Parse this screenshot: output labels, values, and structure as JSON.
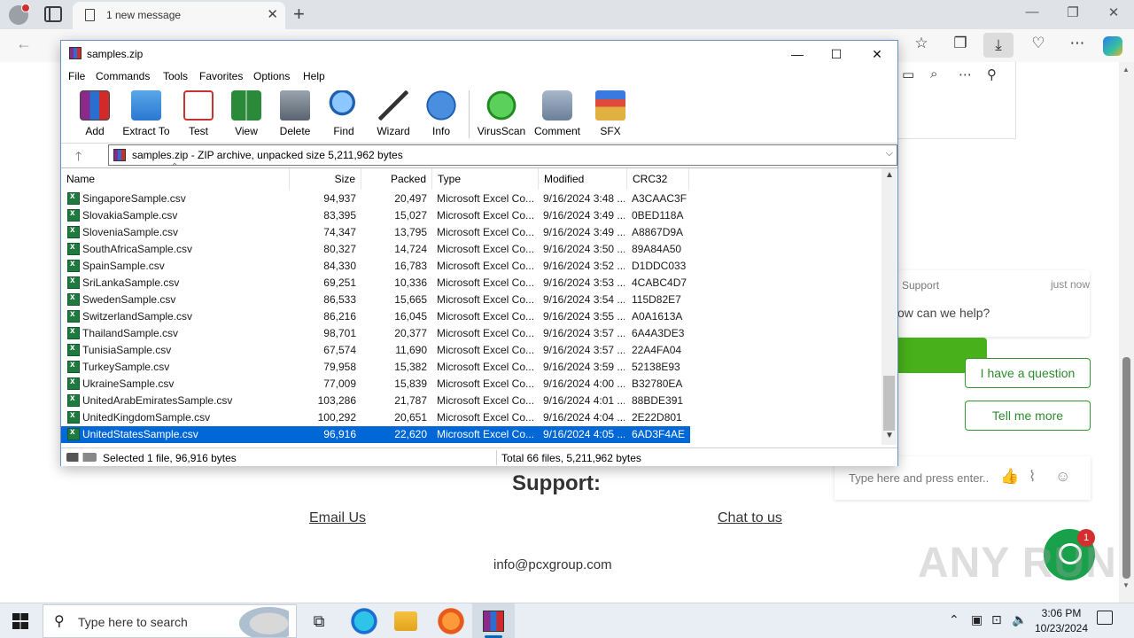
{
  "browser": {
    "tab_title": "1 new message",
    "tab_close": "✕",
    "new_tab": "+",
    "window_minimize": "—",
    "window_restore": "❐",
    "window_close": "✕"
  },
  "toolbar_icons": [
    "favorites-star-icon",
    "collections-icon",
    "extensions-icon",
    "downloads-icon",
    "browser-essentials-icon",
    "more-menu-icon",
    "copilot-icon"
  ],
  "page": {
    "support_heading": "Support:",
    "email_link": "Email Us",
    "chat_link": "Chat to us",
    "contact_email": "info@pcxgroup.com",
    "watermark": "ANY RUN"
  },
  "chat": {
    "agent": "Support",
    "time": "just now",
    "message": "ow can we help?",
    "btn_question": "I have a question",
    "btn_more": "Tell me more",
    "input_placeholder": "Type here and press enter..",
    "badge": "1"
  },
  "winrar": {
    "title": "samples.zip",
    "menu": [
      "File",
      "Commands",
      "Tools",
      "Favorites",
      "Options",
      "Help"
    ],
    "tools": [
      "Add",
      "Extract To",
      "Test",
      "View",
      "Delete",
      "Find",
      "Wizard",
      "Info",
      "VirusScan",
      "Comment",
      "SFX"
    ],
    "path": "samples.zip - ZIP archive, unpacked size 5,211,962 bytes",
    "columns": [
      "Name",
      "Size",
      "Packed",
      "Type",
      "Modified",
      "CRC32"
    ],
    "rows": [
      {
        "name": "SingaporeSample.csv",
        "size": "94,937",
        "packed": "20,497",
        "type": "Microsoft Excel Co...",
        "modified": "9/16/2024 3:48 ...",
        "crc": "A3CAAC3F",
        "selected": false
      },
      {
        "name": "SlovakiaSample.csv",
        "size": "83,395",
        "packed": "15,027",
        "type": "Microsoft Excel Co...",
        "modified": "9/16/2024 3:49 ...",
        "crc": "0BED118A",
        "selected": false
      },
      {
        "name": "SloveniaSample.csv",
        "size": "74,347",
        "packed": "13,795",
        "type": "Microsoft Excel Co...",
        "modified": "9/16/2024 3:49 ...",
        "crc": "A8867D9A",
        "selected": false
      },
      {
        "name": "SouthAfricaSample.csv",
        "size": "80,327",
        "packed": "14,724",
        "type": "Microsoft Excel Co...",
        "modified": "9/16/2024 3:50 ...",
        "crc": "89A84A50",
        "selected": false
      },
      {
        "name": "SpainSample.csv",
        "size": "84,330",
        "packed": "16,783",
        "type": "Microsoft Excel Co...",
        "modified": "9/16/2024 3:52 ...",
        "crc": "D1DDC033",
        "selected": false
      },
      {
        "name": "SriLankaSample.csv",
        "size": "69,251",
        "packed": "10,336",
        "type": "Microsoft Excel Co...",
        "modified": "9/16/2024 3:53 ...",
        "crc": "4CABC4D7",
        "selected": false
      },
      {
        "name": "SwedenSample.csv",
        "size": "86,533",
        "packed": "15,665",
        "type": "Microsoft Excel Co...",
        "modified": "9/16/2024 3:54 ...",
        "crc": "115D82E7",
        "selected": false
      },
      {
        "name": "SwitzerlandSample.csv",
        "size": "86,216",
        "packed": "16,045",
        "type": "Microsoft Excel Co...",
        "modified": "9/16/2024 3:55 ...",
        "crc": "A0A1613A",
        "selected": false
      },
      {
        "name": "ThailandSample.csv",
        "size": "98,701",
        "packed": "20,377",
        "type": "Microsoft Excel Co...",
        "modified": "9/16/2024 3:57 ...",
        "crc": "6A4A3DE3",
        "selected": false
      },
      {
        "name": "TunisiaSample.csv",
        "size": "67,574",
        "packed": "11,690",
        "type": "Microsoft Excel Co...",
        "modified": "9/16/2024 3:57 ...",
        "crc": "22A4FA04",
        "selected": false
      },
      {
        "name": "TurkeySample.csv",
        "size": "79,958",
        "packed": "15,382",
        "type": "Microsoft Excel Co...",
        "modified": "9/16/2024 3:59 ...",
        "crc": "52138E93",
        "selected": false
      },
      {
        "name": "UkraineSample.csv",
        "size": "77,009",
        "packed": "15,839",
        "type": "Microsoft Excel Co...",
        "modified": "9/16/2024 4:00 ...",
        "crc": "B32780EA",
        "selected": false
      },
      {
        "name": "UnitedArabEmiratesSample.csv",
        "size": "103,286",
        "packed": "21,787",
        "type": "Microsoft Excel Co...",
        "modified": "9/16/2024 4:01 ...",
        "crc": "88BDE391",
        "selected": false
      },
      {
        "name": "UnitedKingdomSample.csv",
        "size": "100,292",
        "packed": "20,651",
        "type": "Microsoft Excel Co...",
        "modified": "9/16/2024 4:04 ...",
        "crc": "2E22D801",
        "selected": false
      },
      {
        "name": "UnitedStatesSample.csv",
        "size": "96,916",
        "packed": "22,620",
        "type": "Microsoft Excel Co...",
        "modified": "9/16/2024 4:05 ...",
        "crc": "6AD3F4AE",
        "selected": true
      }
    ],
    "status_left": "Selected 1 file, 96,916 bytes",
    "status_right": "Total 66 files, 5,211,962 bytes"
  },
  "taskbar": {
    "search_placeholder": "Type here to search",
    "time": "3:06 PM",
    "date": "10/23/2024"
  }
}
